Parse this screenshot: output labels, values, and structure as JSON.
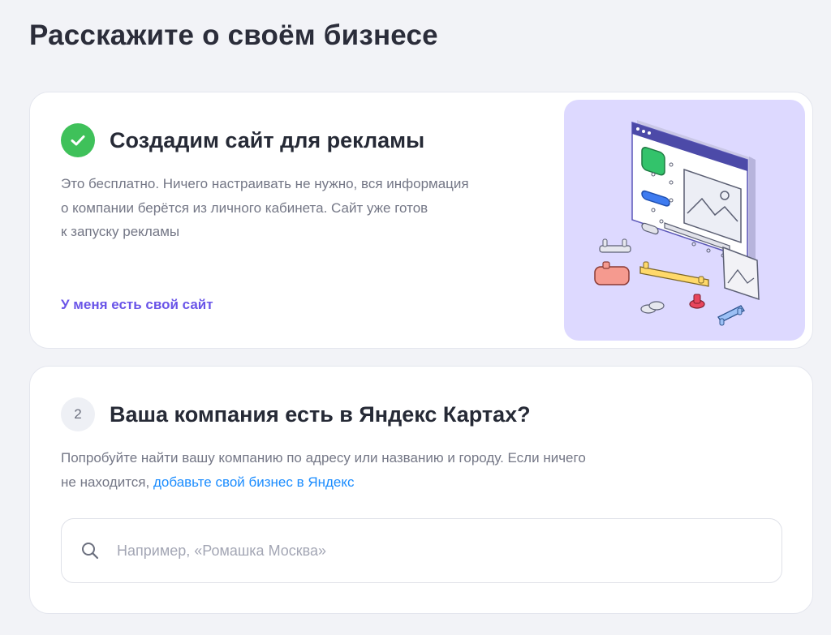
{
  "page": {
    "title": "Расскажите о своём бизнесе"
  },
  "step1": {
    "title": "Создадим сайт для рекламы",
    "description_lines": [
      "Это бесплатно. Ничего настраивать не нужно, вся информация",
      "о компании берётся из личного кабинета. Сайт уже готов",
      "к запуску рекламы"
    ],
    "link": "У меня есть свой сайт",
    "status_icon": "check-icon",
    "illustration": "website-builder-illustration"
  },
  "step2": {
    "number": "2",
    "title": "Ваша компания есть в Яндекс Картах?",
    "description_line1": "Попробуйте найти вашу компанию по адресу или названию и городу. Если ничего",
    "description_line2_prefix": "не находится, ",
    "description_link": "добавьте свой бизнес в Яндекс",
    "search": {
      "placeholder": "Например, «Ромашка Москва»",
      "value": "",
      "icon": "search-icon"
    }
  },
  "colors": {
    "background": "#f2f3f7",
    "success": "#3fc15a",
    "accent_link": "#6a55e8",
    "inline_link": "#1a8cff",
    "illustration_bg": "#ddd9ff"
  }
}
